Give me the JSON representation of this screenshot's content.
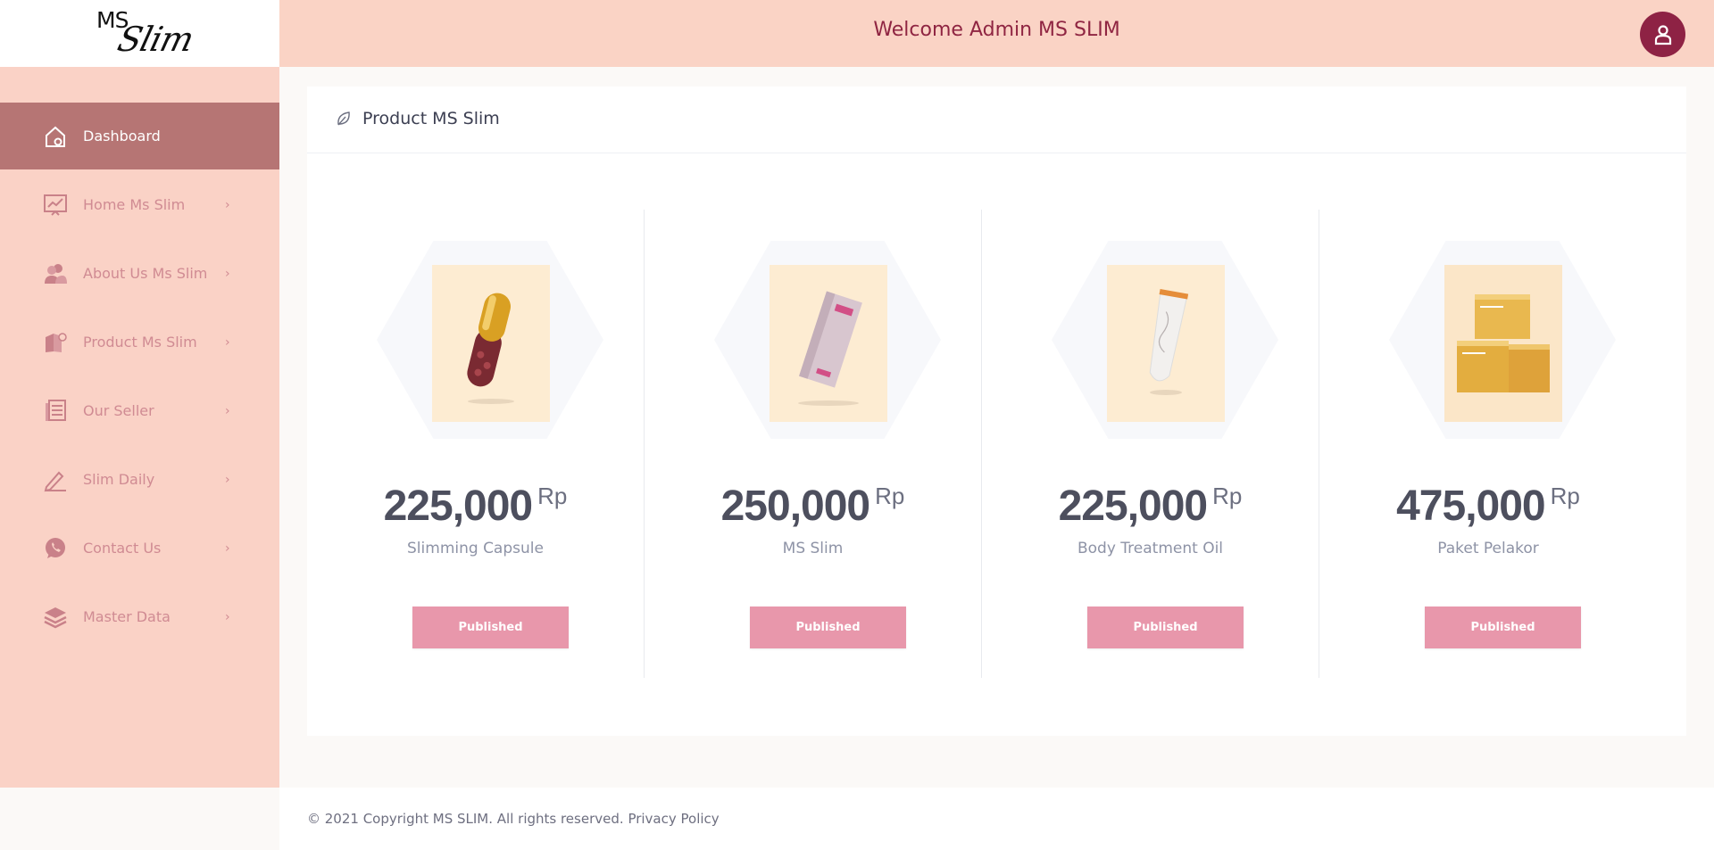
{
  "logo": {
    "line1": "MS",
    "line2": "Slim"
  },
  "header": {
    "title": "Welcome Admin MS SLIM"
  },
  "sidebar": {
    "items": [
      {
        "label": "Dashboard",
        "icon": "home-icon",
        "active": true
      },
      {
        "label": "Home Ms Slim",
        "icon": "chart-icon",
        "chevron": "›"
      },
      {
        "label": "About Us Ms Slim",
        "icon": "users-icon",
        "chevron": "›"
      },
      {
        "label": "Product Ms Slim",
        "icon": "product-icon",
        "chevron": "›"
      },
      {
        "label": "Our Seller",
        "icon": "document-icon",
        "chevron": "›"
      },
      {
        "label": "Slim Daily",
        "icon": "pen-icon",
        "chevron": "›"
      },
      {
        "label": "Contact Us",
        "icon": "whatsapp-icon",
        "chevron": "›"
      },
      {
        "label": "Master Data",
        "icon": "layers-icon",
        "chevron": "›"
      }
    ]
  },
  "main": {
    "card_title": "Product MS Slim",
    "products": [
      {
        "price": "225,000",
        "currency": "Rp",
        "name": "Slimming Capsule",
        "status": "Published",
        "image": "capsule"
      },
      {
        "price": "250,000",
        "currency": "Rp",
        "name": "MS Slim",
        "status": "Published",
        "image": "box"
      },
      {
        "price": "225,000",
        "currency": "Rp",
        "name": "Body Treatment Oil",
        "status": "Published",
        "image": "tube"
      },
      {
        "price": "475,000",
        "currency": "Rp",
        "name": "Paket Pelakor",
        "status": "Published",
        "image": "boxes"
      }
    ]
  },
  "footer": {
    "copyright": "© 2021 Copyright MS SLIM. All rights reserved.",
    "link": "Privacy Policy"
  },
  "colors": {
    "sidebar_bg": "#fad2c6",
    "active_bg": "#b67574",
    "topbar_bg": "#fad3c5",
    "title_color": "#8f2542",
    "avatar_bg": "#8e2244",
    "button_bg": "#e897ab"
  }
}
